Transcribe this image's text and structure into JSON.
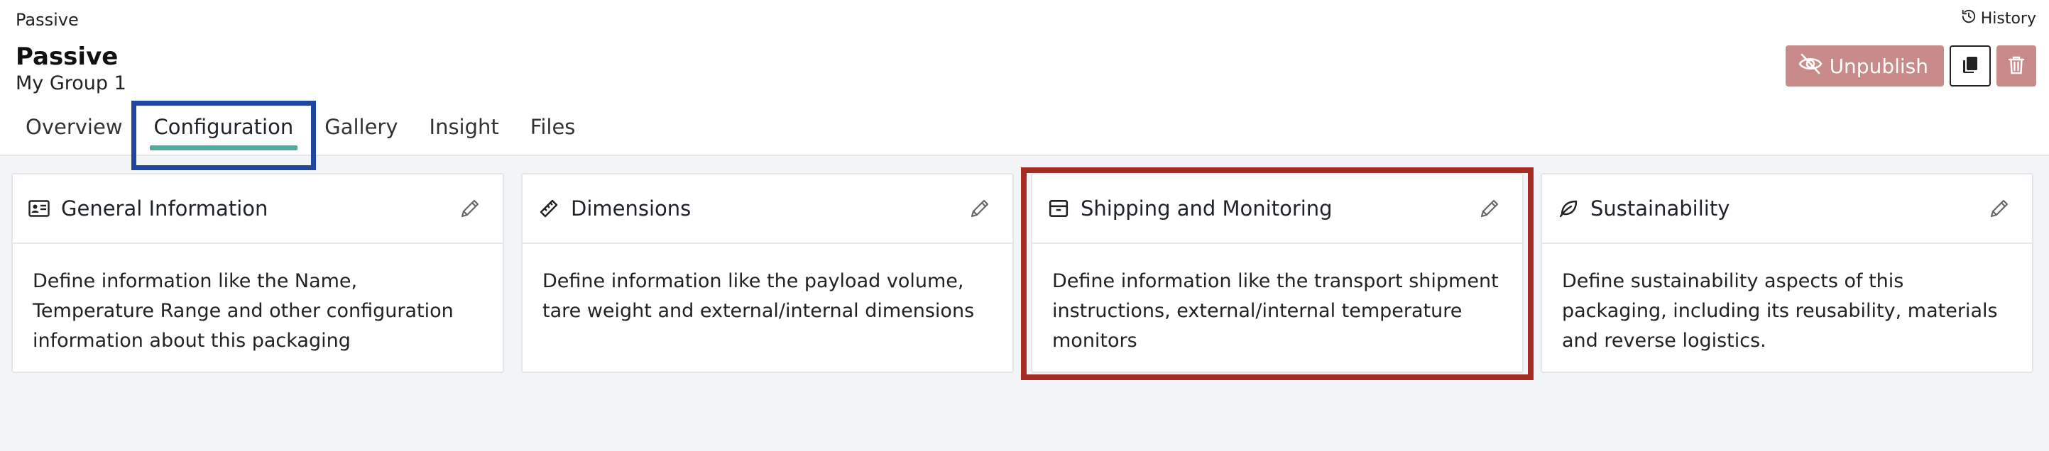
{
  "breadcrumb": "Passive",
  "history_label": "History",
  "title": "Passive",
  "subtitle": "My Group 1",
  "actions": {
    "unpublish_label": "Unpublish"
  },
  "tabs": [
    {
      "label": "Overview"
    },
    {
      "label": "Configuration"
    },
    {
      "label": "Gallery"
    },
    {
      "label": "Insight"
    },
    {
      "label": "Files"
    }
  ],
  "active_tab": "Configuration",
  "cards": [
    {
      "icon": "id-card-icon",
      "title": "General Information",
      "description": "Define information like the Name, Temperature Range and other configuration information about this packaging"
    },
    {
      "icon": "ruler-icon",
      "title": "Dimensions",
      "description": "Define information like the payload volume, tare weight and external/internal dimensions"
    },
    {
      "icon": "box-icon",
      "title": "Shipping and Monitoring",
      "description": "Define information like the transport shipment instructions, external/internal temperature monitors"
    },
    {
      "icon": "leaf-icon",
      "title": "Sustainability",
      "description": "Define sustainability aspects of this packaging, including its reusability, materials and reverse logistics."
    }
  ],
  "colors": {
    "accent_tab": "#4daea0",
    "danger_muted": "#c98a8a",
    "highlight_blue": "#1f47a0",
    "highlight_red": "#a52c22"
  }
}
